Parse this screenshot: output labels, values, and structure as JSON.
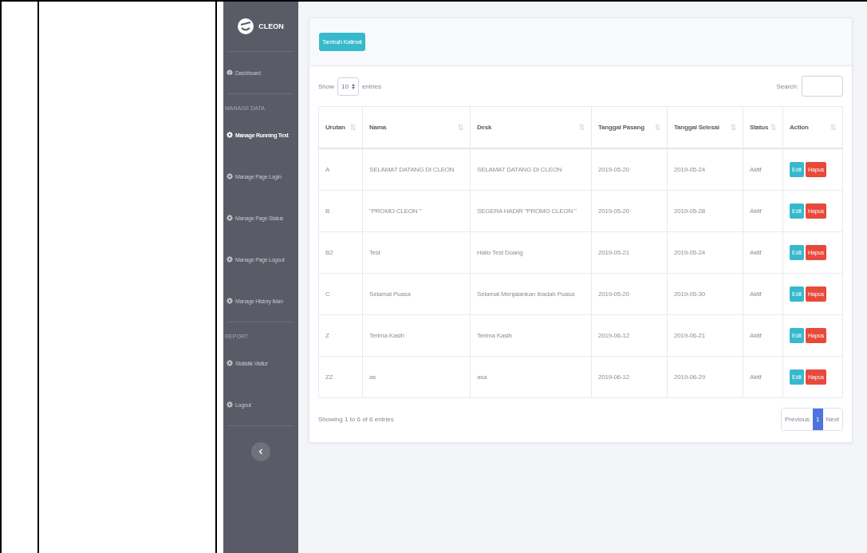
{
  "sidebar": {
    "brand": "CLEON",
    "items": [
      {
        "kind": "link",
        "label": "Dashboard",
        "selected": false
      },
      {
        "kind": "divider"
      },
      {
        "kind": "heading",
        "label": "MANAGE DATA"
      },
      {
        "kind": "link",
        "label": "Manage Running Text",
        "selected": true
      },
      {
        "kind": "link",
        "label": "Manage Page Login",
        "selected": false
      },
      {
        "kind": "link",
        "label": "Manage Page Status",
        "selected": false
      },
      {
        "kind": "link",
        "label": "Manage Page Logout",
        "selected": false
      },
      {
        "kind": "link",
        "label": "Manage History Iklan",
        "selected": false
      },
      {
        "kind": "divider"
      },
      {
        "kind": "heading",
        "label": "REPORT"
      },
      {
        "kind": "link",
        "label": "Statistik Visitor",
        "selected": false
      },
      {
        "kind": "link",
        "label": "Logout",
        "selected": false
      },
      {
        "kind": "divider"
      }
    ]
  },
  "add_button": "Tambah Kalimat",
  "length_control": {
    "before": "Show",
    "value": "10",
    "after": "entries"
  },
  "search": {
    "label": "Search:"
  },
  "table": {
    "columns": [
      "Urutan",
      "Nama",
      "Desk",
      "Tanggal Pasang",
      "Tanggal Selesai",
      "Status",
      "Action"
    ],
    "rows": [
      {
        "urutan": "A",
        "nama": "SELAMAT DATANG DI CLEON",
        "desk": "SELAMAT DATANG DI CLEON",
        "tanggal_pasang": "2019-05-20",
        "tanggal_selesai": "2019-05-24",
        "status": "Aktif",
        "actions": [
          "Edit",
          "Hapus"
        ]
      },
      {
        "urutan": "B",
        "nama": "\"PROMO CLEON \"",
        "desk": "SEGERA HADIR \"PROMO CLEON \"",
        "tanggal_pasang": "2019-05-20",
        "tanggal_selesai": "2019-05-28",
        "status": "Aktif",
        "actions": [
          "Edit",
          "Hapus"
        ]
      },
      {
        "urutan": "B2",
        "nama": "Test",
        "desk": "Hallo Test Doang",
        "tanggal_pasang": "2019-05-21",
        "tanggal_selesai": "2019-05-24",
        "status": "Aktif",
        "actions": [
          "Edit",
          "Hapus"
        ]
      },
      {
        "urutan": "C",
        "nama": "Selamat Puasa",
        "desk": "Selamat Menjalankan Ibadah Puasa",
        "tanggal_pasang": "2019-05-20",
        "tanggal_selesai": "2019-05-30",
        "status": "Aktif",
        "actions": [
          "Edit",
          "Hapus"
        ]
      },
      {
        "urutan": "Z",
        "nama": "Terima Kasih",
        "desk": "Terima Kasih",
        "tanggal_pasang": "2019-06-12",
        "tanggal_selesai": "2019-06-21",
        "status": "Aktif",
        "actions": [
          "Edit",
          "Hapus"
        ]
      },
      {
        "urutan": "ZZ",
        "nama": "as",
        "desk": "asa",
        "tanggal_pasang": "2019-06-12",
        "tanggal_selesai": "2019-06-29",
        "status": "Aktif",
        "actions": [
          "Edit",
          "Hapus"
        ]
      }
    ]
  },
  "info": "Showing 1 to 6 of 6 entries",
  "pagination": [
    {
      "label": "Previous",
      "selected": false
    },
    {
      "label": "1",
      "selected": true
    },
    {
      "label": "Next",
      "selected": false
    }
  ]
}
